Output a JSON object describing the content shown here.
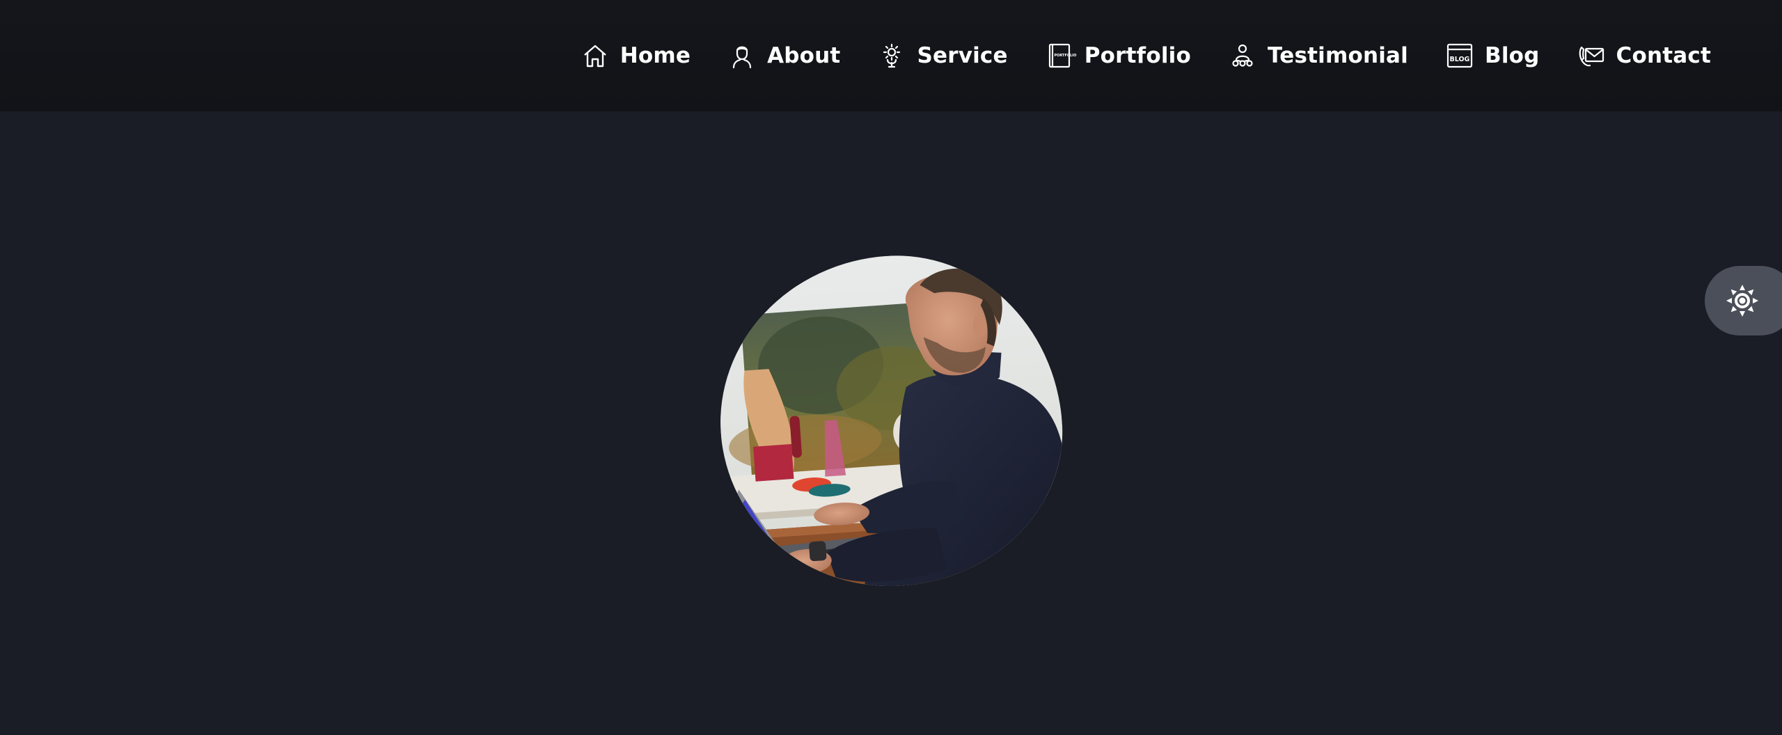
{
  "nav": {
    "items": [
      {
        "label": "Home",
        "icon": "home-icon"
      },
      {
        "label": "About",
        "icon": "user-icon"
      },
      {
        "label": "Service",
        "icon": "service-icon"
      },
      {
        "label": "Portfolio",
        "icon": "portfolio-icon"
      },
      {
        "label": "Testimonial",
        "icon": "testimonial-icon"
      },
      {
        "label": "Blog",
        "icon": "blog-icon"
      },
      {
        "label": "Contact",
        "icon": "contact-icon"
      }
    ]
  },
  "portfolio_icon_text": "PORTFOLIO",
  "blog_icon_text": "BLOG",
  "hero": {
    "avatar": "avatar-photo"
  },
  "theme_toggle": {
    "icon": "sun-icon",
    "mode": "dark"
  },
  "colors": {
    "background": "#1a1d25",
    "header": "#121418",
    "text": "#ffffff",
    "toggle": "#4b4f59"
  }
}
